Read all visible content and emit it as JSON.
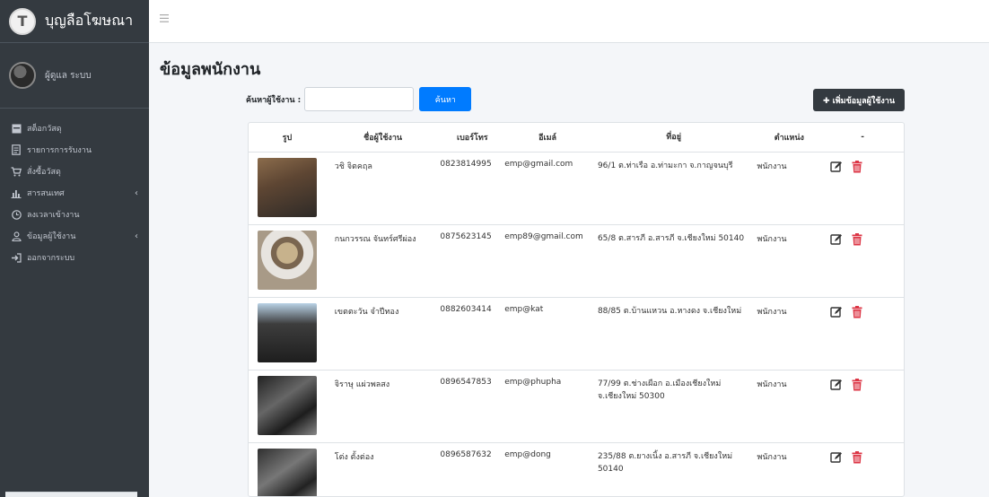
{
  "brand": {
    "title": "บุญลือโฆษณา",
    "logo_icon": "brand-logo-icon"
  },
  "user": {
    "name": "ผู้ดูแล ระบบ"
  },
  "sidebar": {
    "items": [
      {
        "label": "สต็อกวัสดุ",
        "icon": "box-icon",
        "arrow": ""
      },
      {
        "label": "รายการการรับงาน",
        "icon": "document-icon",
        "arrow": ""
      },
      {
        "label": "สั่งซื้อวัสดุ",
        "icon": "cart-icon",
        "arrow": ""
      },
      {
        "label": "สารสนเทศ",
        "icon": "chart-icon",
        "arrow": "‹"
      },
      {
        "label": "ลงเวลาเข้างาน",
        "icon": "clock-icon",
        "arrow": ""
      },
      {
        "label": "ข้อมูลผู้ใช้งาน",
        "icon": "user-icon",
        "arrow": "‹"
      },
      {
        "label": "ออกจากระบบ",
        "icon": "logout-icon",
        "arrow": ""
      }
    ]
  },
  "page": {
    "title": "ข้อมูลพนักงาน"
  },
  "search": {
    "label": "ค้นหาผู้ใช้งาน :",
    "value": "",
    "placeholder": "",
    "button": "ค้นหา"
  },
  "add_button": {
    "label": "✚ เพิ่มข้อมูลผู้ใช้งาน"
  },
  "table": {
    "headers": [
      "รูป",
      "ชื่อผู้ใช้งาน",
      "เบอร์โทร",
      "อีเมล์",
      "ที่อยู่",
      "ตำแหน่ง",
      "-"
    ],
    "rows": [
      {
        "name": "วชิ จิตคฤล",
        "phone": "0823814995",
        "email": "emp@gmail.com",
        "address": "96/1 ต.ท่าเรือ อ.ท่ามะกา จ.กาญจนบุรี",
        "position": "พนักงาน"
      },
      {
        "name": "กนกวรรณ จันทร์ศรีผ่อง",
        "phone": "0875623145",
        "email": "emp89@gmail.com",
        "address": "65/8 ต.สารภี อ.สารภี จ.เชียงใหม่ 50140",
        "position": "พนักงาน"
      },
      {
        "name": "เขตตะวัน จำปีทอง",
        "phone": "0882603414",
        "email": "emp@kat",
        "address": "88/85 ต.บ้านแหวน อ.หางดง จ.เชียงใหม่",
        "position": "พนักงาน"
      },
      {
        "name": "จิราษุ แผ่วพลสง",
        "phone": "0896547853",
        "email": "emp@phupha",
        "address": "77/99 ต.ช่างเผือก อ.เมืองเชียงใหม่ จ.เชียงใหม่ 50300",
        "position": "พนักงาน"
      },
      {
        "name": "โต่ง ตั้งต่อง",
        "phone": "0896587632",
        "email": "emp@dong",
        "address": "235/88 ต.ยางเนิ้ง อ.สารภี จ.เชียงใหม่ 50140",
        "position": "พนักงาน"
      }
    ]
  },
  "colors": {
    "sidebar": "#343a40",
    "primary": "#007bff",
    "dark_button": "#343a40",
    "delete": "#dc3545"
  }
}
